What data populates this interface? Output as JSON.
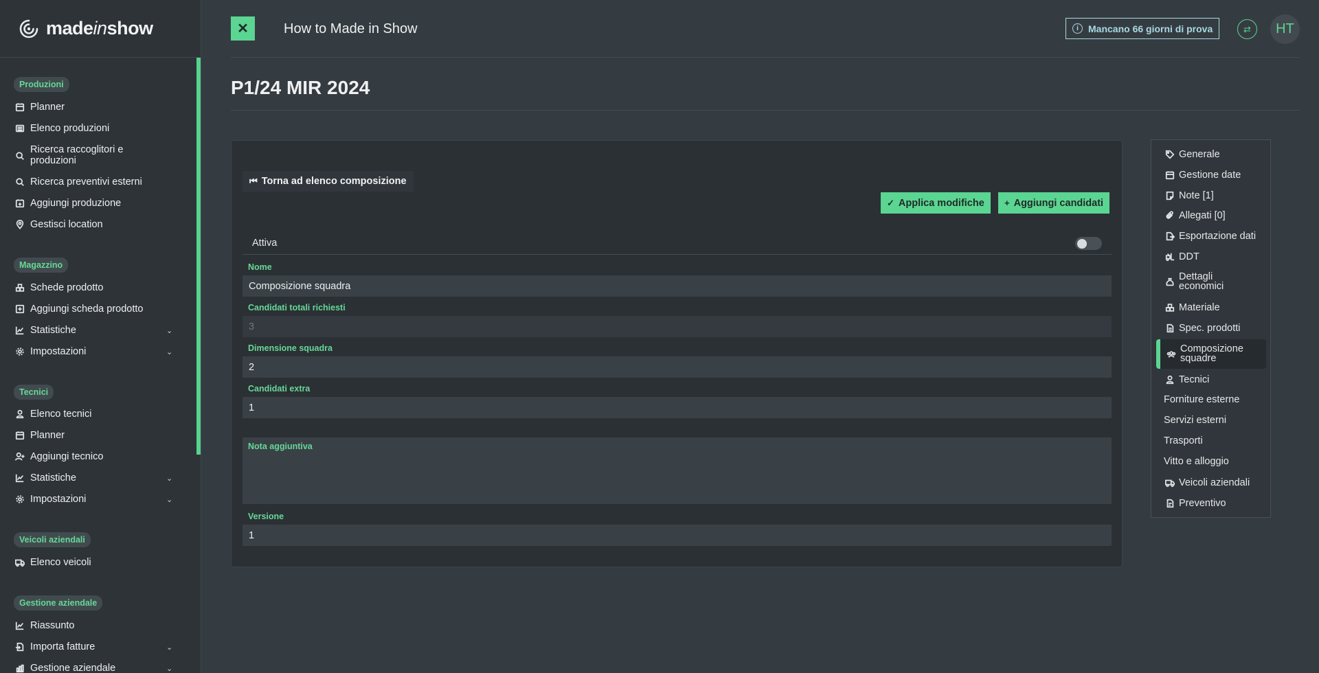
{
  "logo": {
    "brand_pre": "made",
    "brand_mid": "in",
    "brand_post": "show"
  },
  "sidebar": {
    "sections": [
      {
        "badge": "Produzioni",
        "items": [
          {
            "label": "Planner",
            "icon": "calendar-icon"
          },
          {
            "label": "Elenco produzioni",
            "icon": "list-icon"
          },
          {
            "label": "Ricerca raccoglitori e produzioni",
            "icon": "search-icon"
          },
          {
            "label": "Ricerca preventivi esterni",
            "icon": "search-icon"
          },
          {
            "label": "Aggiungi produzione",
            "icon": "calendar-plus-icon"
          },
          {
            "label": "Gestisci location",
            "icon": "map-pin-icon"
          }
        ]
      },
      {
        "badge": "Magazzino",
        "items": [
          {
            "label": "Schede prodotto",
            "icon": "boxes-icon"
          },
          {
            "label": "Aggiungi scheda prodotto",
            "icon": "plus-square-icon"
          },
          {
            "label": "Statistiche",
            "icon": "chart-line-icon",
            "chevron": "⌄"
          },
          {
            "label": "Impostazioni",
            "icon": "gear-icon",
            "chevron": "⌄"
          }
        ]
      },
      {
        "badge": "Tecnici",
        "items": [
          {
            "label": "Elenco tecnici",
            "icon": "user-icon"
          },
          {
            "label": "Planner",
            "icon": "calendar-icon"
          },
          {
            "label": "Aggiungi tecnico",
            "icon": "user-plus-icon"
          },
          {
            "label": "Statistiche",
            "icon": "chart-line-icon",
            "chevron": "⌄"
          },
          {
            "label": "Impostazioni",
            "icon": "gear-icon",
            "chevron": "⌄"
          }
        ]
      },
      {
        "badge": "Veicoli aziendali",
        "items": [
          {
            "label": "Elenco veicoli",
            "icon": "truck-icon"
          }
        ]
      },
      {
        "badge": "Gestione aziendale",
        "items": [
          {
            "label": "Riassunto",
            "icon": "chart-line-icon"
          },
          {
            "label": "Importa fatture",
            "icon": "file-import-icon",
            "chevron": "⌄"
          },
          {
            "label": "Gestione aziendale",
            "icon": "chart-bar-icon",
            "chevron": "⌄"
          }
        ]
      }
    ]
  },
  "topbar": {
    "close_label": "✕",
    "title": "How to Made in Show",
    "trial_label": "Mancano 66 giorni di prova",
    "avatar_initials": "HT"
  },
  "page": {
    "title": "P1/24 MIR 2024"
  },
  "form": {
    "back_label": "Torna ad elenco composizione",
    "apply_label": "Applica modifiche",
    "add_candidates_label": "Aggiungi candidati",
    "toggle_label": "Attiva",
    "toggle_on": false,
    "fields": {
      "nome_label": "Nome",
      "nome_value": "Composizione squadra",
      "candidati_totali_label": "Candidati totali richiesti",
      "candidati_totali_value": "3",
      "dimensione_label": "Dimensione squadra",
      "dimensione_value": "2",
      "extra_label": "Candidati extra",
      "extra_value": "1",
      "nota_label": "Nota aggiuntiva",
      "nota_value": "",
      "versione_label": "Versione",
      "versione_value": "1"
    }
  },
  "right_nav": {
    "active": "Composizione squadre",
    "items": [
      {
        "label": "Generale",
        "icon": "tag-icon"
      },
      {
        "label": "Gestione date",
        "icon": "calendar-icon"
      },
      {
        "label": "Note [1]",
        "icon": "note-icon"
      },
      {
        "label": "Allegati [0]",
        "icon": "paperclip-icon"
      },
      {
        "label": "Esportazione dati",
        "icon": "file-export-icon"
      },
      {
        "label": "DDT",
        "icon": "forklift-icon"
      },
      {
        "label": "Dettagli economici",
        "icon": "money-bag-icon"
      },
      {
        "label": "Materiale",
        "icon": "boxes-icon"
      },
      {
        "label": "Spec. prodotti",
        "icon": "file-icon"
      },
      {
        "label": "Composizione squadre",
        "icon": "users-group-icon"
      },
      {
        "label": "Tecnici",
        "icon": "user-icon"
      },
      {
        "label": "Forniture esterne",
        "icon": ""
      },
      {
        "label": "Servizi esterni",
        "icon": ""
      },
      {
        "label": "Trasporti",
        "icon": ""
      },
      {
        "label": "Vitto e alloggio",
        "icon": ""
      },
      {
        "label": "Veicoli aziendali",
        "icon": "truck-icon"
      },
      {
        "label": "Preventivo",
        "icon": "file-invoice-icon"
      }
    ]
  },
  "colors": {
    "accent": "#5bd592",
    "background": "#353c41",
    "sidebar": "#2d3337",
    "card": "#2b3035",
    "info": "#a8d9e4"
  }
}
